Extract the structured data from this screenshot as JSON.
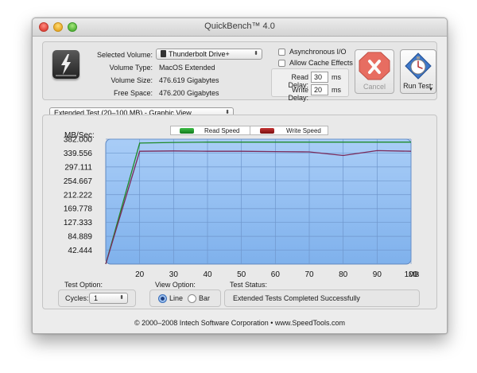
{
  "window": {
    "title": "QuickBench™ 4.0"
  },
  "volume": {
    "labels": {
      "selected": "Selected Volume:",
      "type": "Volume Type:",
      "size": "Volume Size:",
      "free": "Free Space:"
    },
    "selected_value": "Thunderbolt Drive+",
    "type_value": "MacOS Extended",
    "size_value": "476.619 Gigabytes",
    "free_value": "476.200 Gigabytes",
    "drive_icon": "thunderbolt-drive-icon"
  },
  "options": {
    "async_label": "Asynchronous I/O",
    "async_checked": false,
    "cache_label": "Allow Cache Effects",
    "cache_checked": false,
    "read_delay_label": "Read Delay:",
    "read_delay_value": "30",
    "write_delay_label": "Write Delay:",
    "write_delay_value": "20",
    "unit": "ms"
  },
  "buttons": {
    "cancel_label": "Cancel",
    "run_label": "Run Test:"
  },
  "test": {
    "selected": "Extended Test (20–100 MB) - Graphic View"
  },
  "legend": {
    "read_label": "Read Speed",
    "write_label": "Write Speed",
    "read_color": "#1e8a28",
    "write_color": "#8c1414"
  },
  "chart_data": {
    "type": "line",
    "ylabel": "MB/Sec:",
    "xlabel": "MB",
    "x": [
      0,
      20,
      30,
      40,
      50,
      60,
      70,
      80,
      90,
      100
    ],
    "xticks": [
      20,
      30,
      40,
      50,
      60,
      70,
      80,
      90,
      100
    ],
    "yticks": [
      "382.000",
      "339.556",
      "297.111",
      "254.667",
      "212.222",
      "169.778",
      "127.333",
      "84.889",
      "42.444"
    ],
    "xlim": [
      10,
      100
    ],
    "ylim": [
      0,
      382
    ],
    "series": [
      {
        "name": "Read Speed",
        "color": "#1e8a28",
        "x": [
          10,
          20,
          30,
          40,
          50,
          60,
          70,
          80,
          90,
          100
        ],
        "values": [
          0,
          370,
          372,
          373,
          373,
          373,
          373,
          373,
          373,
          373
        ]
      },
      {
        "name": "Write Speed",
        "color": "#7a2a5a",
        "x": [
          10,
          20,
          30,
          40,
          50,
          60,
          70,
          80,
          90,
          100
        ],
        "values": [
          0,
          345,
          346,
          345,
          345,
          344,
          343,
          332,
          347,
          345
        ]
      }
    ],
    "plot_background": "#8fbdf2",
    "grid": true
  },
  "bottom": {
    "test_option_label": "Test Option:",
    "cycles_label": "Cycles:",
    "cycles_value": "1",
    "view_option_label": "View Option:",
    "view_line_label": "Line",
    "view_bar_label": "Bar",
    "view_selected": "Line",
    "status_label": "Test Status:",
    "status_value": "Extended Tests Completed Successfully"
  },
  "footer": {
    "copyright": "© 2000–2008 Intech Software Corporation • www.SpeedTools.com"
  }
}
